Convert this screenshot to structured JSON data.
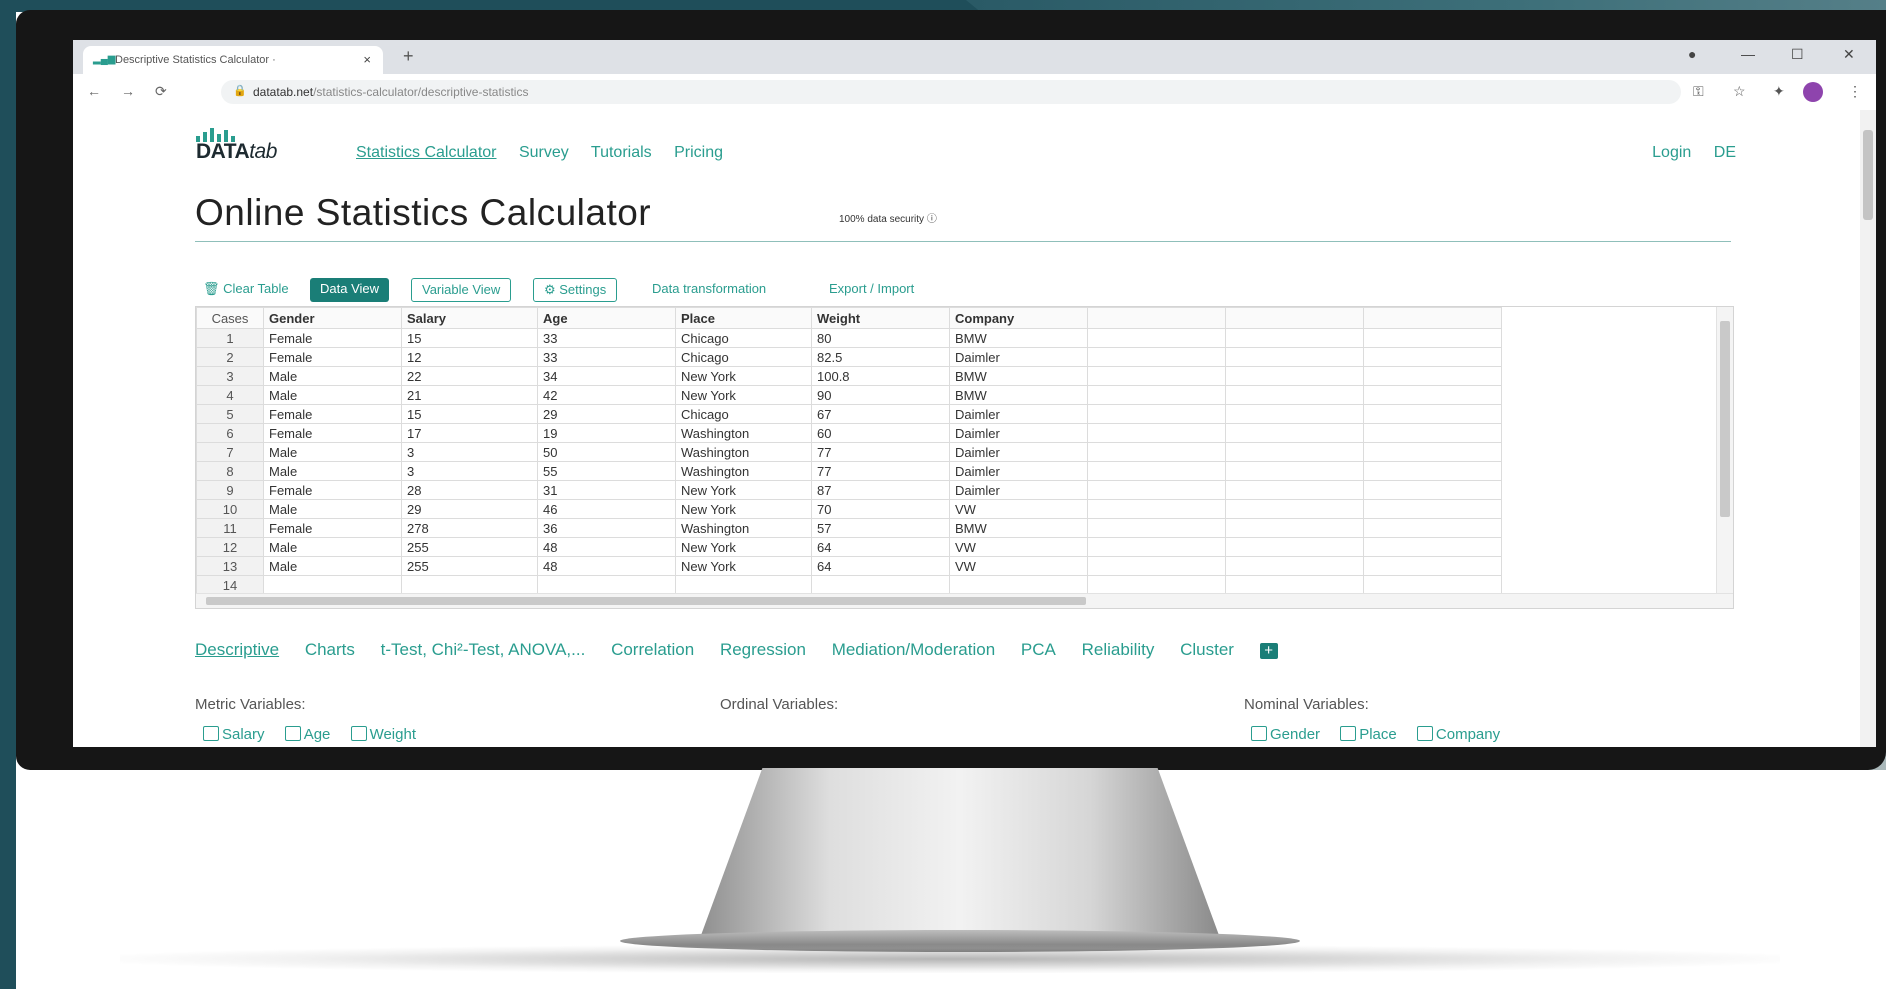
{
  "browser": {
    "tab_title": "Descriptive Statistics Calculator ·",
    "tab_close": "×",
    "new_tab": "+",
    "url_host": "datatab.net",
    "url_path": "/statistics-calculator/descriptive-statistics"
  },
  "site": {
    "logo_word": "DATA",
    "logo_word_italic": "tab",
    "nav": [
      "Statistics Calculator",
      "Survey",
      "Tutorials",
      "Pricing"
    ],
    "login": "Login",
    "lang": "DE"
  },
  "page": {
    "title": "Online Statistics Calculator",
    "security_note": "100% data security ⓘ"
  },
  "toolbar": {
    "clear": "🗑 Clear Table",
    "data_view": "Data View",
    "variable_view": "Variable View",
    "settings": "⚙ Settings",
    "transform": "Data transformation",
    "export": "Export / Import"
  },
  "table": {
    "headers": [
      "Cases",
      "Gender",
      "Salary",
      "Age",
      "Place",
      "Weight",
      "Company",
      "",
      "",
      ""
    ],
    "rows": [
      [
        "1",
        "Female",
        "15",
        "33",
        "Chicago",
        "80",
        "BMW",
        "",
        "",
        ""
      ],
      [
        "2",
        "Female",
        "12",
        "33",
        "Chicago",
        "82.5",
        "Daimler",
        "",
        "",
        ""
      ],
      [
        "3",
        "Male",
        "22",
        "34",
        "New York",
        "100.8",
        "BMW",
        "",
        "",
        ""
      ],
      [
        "4",
        "Male",
        "21",
        "42",
        "New York",
        "90",
        "BMW",
        "",
        "",
        ""
      ],
      [
        "5",
        "Female",
        "15",
        "29",
        "Chicago",
        "67",
        "Daimler",
        "",
        "",
        ""
      ],
      [
        "6",
        "Female",
        "17",
        "19",
        "Washington",
        "60",
        "Daimler",
        "",
        "",
        ""
      ],
      [
        "7",
        "Male",
        "3",
        "50",
        "Washington",
        "77",
        "Daimler",
        "",
        "",
        ""
      ],
      [
        "8",
        "Male",
        "3",
        "55",
        "Washington",
        "77",
        "Daimler",
        "",
        "",
        ""
      ],
      [
        "9",
        "Female",
        "28",
        "31",
        "New York",
        "87",
        "Daimler",
        "",
        "",
        ""
      ],
      [
        "10",
        "Male",
        "29",
        "46",
        "New York",
        "70",
        "VW",
        "",
        "",
        ""
      ],
      [
        "11",
        "Female",
        "278",
        "36",
        "Washington",
        "57",
        "BMW",
        "",
        "",
        ""
      ],
      [
        "12",
        "Male",
        "255",
        "48",
        "New York",
        "64",
        "VW",
        "",
        "",
        ""
      ],
      [
        "13",
        "Male",
        "255",
        "48",
        "New York",
        "64",
        "VW",
        "",
        "",
        ""
      ],
      [
        "14",
        "",
        "",
        "",
        "",
        "",
        "",
        "",
        "",
        ""
      ]
    ]
  },
  "analysis_tabs": [
    "Descriptive",
    "Charts",
    "t-Test, Chi²-Test, ANOVA,...",
    "Correlation",
    "Regression",
    "Mediation/Moderation",
    "PCA",
    "Reliability",
    "Cluster"
  ],
  "analysis_plus": "+",
  "variables": {
    "metric_label": "Metric Variables:",
    "ordinal_label": "Ordinal Variables:",
    "nominal_label": "Nominal Variables:",
    "metric": [
      "Salary",
      "Age",
      "Weight"
    ],
    "nominal": [
      "Gender",
      "Place",
      "Company"
    ]
  },
  "colors": {
    "accent": "#2a9d8f",
    "accent_dark": "#1a7e77"
  }
}
